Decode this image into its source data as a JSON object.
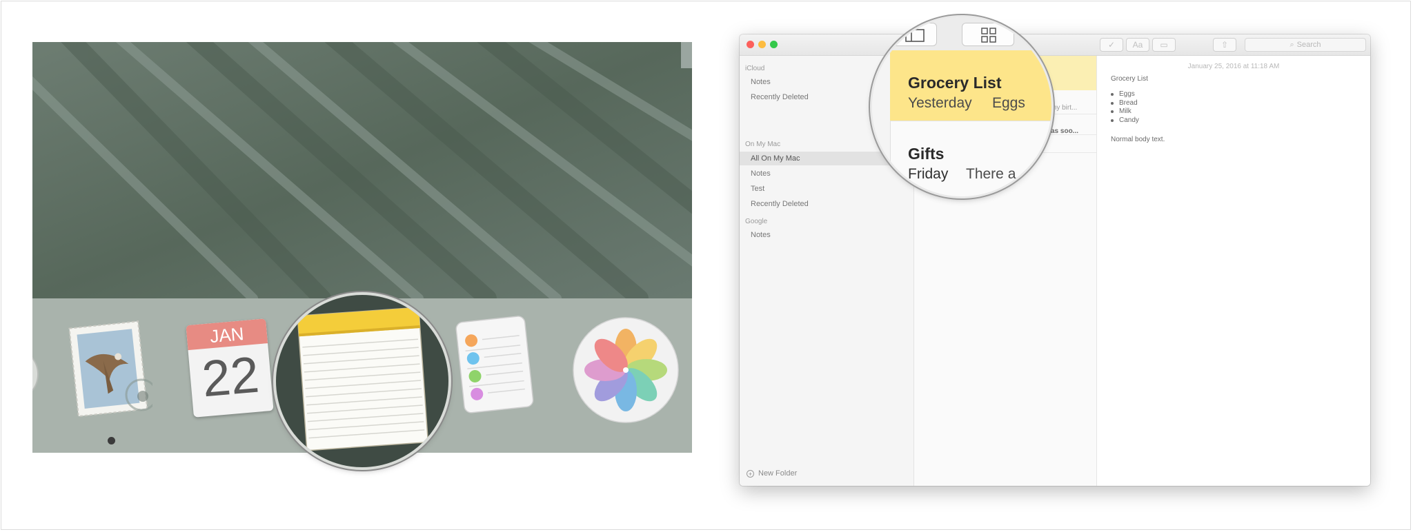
{
  "dock": {
    "calendar": {
      "month": "JAN",
      "day": "22"
    }
  },
  "notes": {
    "search_placeholder": "Search",
    "format_button": "Aa",
    "sidebar": {
      "sections": [
        {
          "header": "iCloud",
          "items": [
            "Notes",
            "Recently Deleted"
          ]
        },
        {
          "header": "On My Mac",
          "items": [
            "All On My Mac",
            "Notes",
            "Test",
            "Recently Deleted"
          ]
        },
        {
          "header": "Google",
          "items": [
            "Notes"
          ]
        }
      ],
      "selected_item": "All On My Mac",
      "new_folder": "New Folder"
    },
    "list": {
      "fragments": [
        "my birt...",
        "as soo..."
      ]
    },
    "editor": {
      "date": "January 25, 2016 at 11:18 AM",
      "title": "Grocery List",
      "bullets": [
        "Eggs",
        "Bread",
        "Milk",
        "Candy"
      ],
      "body": "Normal body text."
    },
    "magnified": {
      "note1": {
        "title": "Grocery List",
        "date": "Yesterday",
        "preview": "Eggs"
      },
      "note2": {
        "title": "Gifts",
        "date": "Friday",
        "preview": "There a"
      }
    }
  },
  "colors": {
    "note_highlight": "#fde58a",
    "close": "#fc605c",
    "minimize": "#fdbc40",
    "zoom": "#34c84a"
  }
}
